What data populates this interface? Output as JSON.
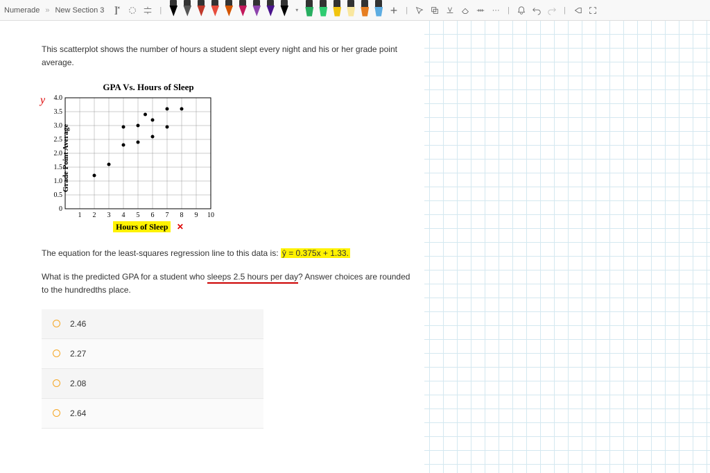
{
  "breadcrumb": {
    "app": "Numerade",
    "section": "New Section 3"
  },
  "pen_colors": [
    "#000000",
    "#555555",
    "#c0392b",
    "#e74c3c",
    "#d35400",
    "#c2185b",
    "#8e44ad",
    "#4a148c",
    "#000000"
  ],
  "highlighter_colors": [
    "#27ae60",
    "#2ecc71",
    "#f1c40f",
    "#f9e79f",
    "#e67e22",
    "#5dade2"
  ],
  "paper": {
    "intro": "This scatterplot shows the number of hours a student slept every night and his or her grade point average.",
    "equation_prefix": "The equation for the least-squares regression line to this data is: ",
    "equation": "ŷ = 0.375x + 1.33.",
    "question_prefix": "What is the predicted GPA for a student who ",
    "question_underlined": "sleeps 2.5 hours per day",
    "question_suffix": "?  Answer choices are rounded to the hundredths place.",
    "answers": [
      "2.46",
      "2.27",
      "2.08",
      "2.64"
    ],
    "annotation_y": "y",
    "annotation_x": "✕"
  },
  "chart_data": {
    "type": "scatter",
    "title": "GPA Vs. Hours of Sleep",
    "xlabel": "Hours of Sleep",
    "ylabel": "Grade Point Average",
    "xlim": [
      0,
      10
    ],
    "ylim": [
      0,
      4.0
    ],
    "x_ticks": [
      1,
      2,
      3,
      4,
      5,
      6,
      7,
      8,
      9,
      10
    ],
    "y_ticks": [
      0,
      0.5,
      1.0,
      1.5,
      2.0,
      2.5,
      3.0,
      3.5,
      4.0
    ],
    "points": [
      {
        "x": 2,
        "y": 1.2
      },
      {
        "x": 3,
        "y": 1.6
      },
      {
        "x": 4,
        "y": 2.3
      },
      {
        "x": 4,
        "y": 2.95
      },
      {
        "x": 5,
        "y": 2.4
      },
      {
        "x": 5,
        "y": 3.0
      },
      {
        "x": 5.5,
        "y": 3.4
      },
      {
        "x": 6,
        "y": 2.6
      },
      {
        "x": 6,
        "y": 3.2
      },
      {
        "x": 7,
        "y": 3.6
      },
      {
        "x": 7,
        "y": 2.95
      },
      {
        "x": 8,
        "y": 3.6
      }
    ]
  }
}
